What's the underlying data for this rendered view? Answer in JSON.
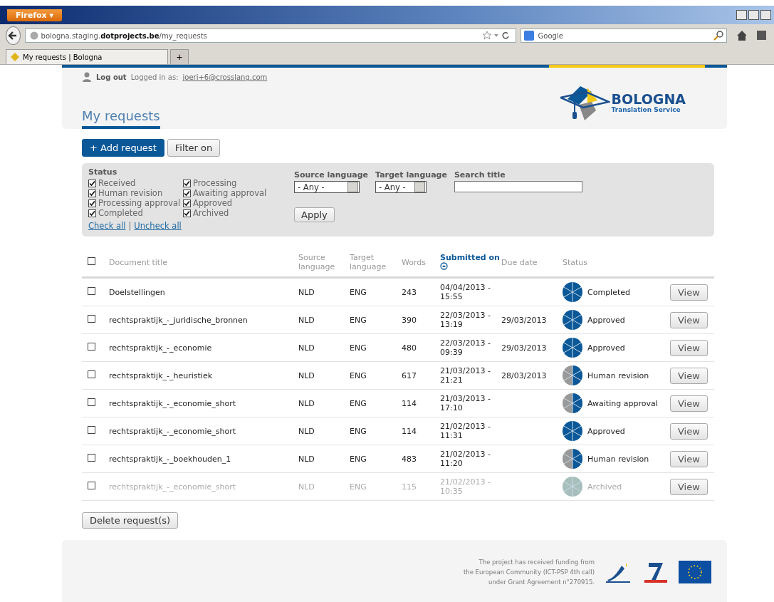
{
  "browser": {
    "menu_button": "Firefox",
    "menu_caret": "▾",
    "url": "bologna.staging.**dotprojects.be**/my_requests",
    "search_placeholder": "Google",
    "tab_title": "My requests | Bologna",
    "new_tab": "+"
  },
  "header": {
    "logout": "Log out",
    "logged_in_label": "Logged in as:",
    "user_email": "joeri+6@crosslang.com",
    "title": "My requests",
    "logo_name": "BOLOGNA",
    "logo_subtitle": "Translation Service"
  },
  "actions": {
    "add": "+ Add request",
    "filter": "Filter on"
  },
  "filter": {
    "status_label": "Status",
    "statuses": [
      {
        "label": "Received",
        "checked": true
      },
      {
        "label": "Human revision",
        "checked": true
      },
      {
        "label": "Processing approval",
        "checked": true
      },
      {
        "label": "Completed",
        "checked": true
      },
      {
        "label": "Processing",
        "checked": true
      },
      {
        "label": "Awaiting approval",
        "checked": true
      },
      {
        "label": "Approved",
        "checked": true
      },
      {
        "label": "Archived",
        "checked": true
      }
    ],
    "check_all": "Check all",
    "uncheck_all": "Uncheck all",
    "separator": "|",
    "source_label": "Source language",
    "source_value": "- Any -",
    "target_label": "Target language",
    "target_value": "- Any -",
    "search_label": "Search title",
    "apply": "Apply"
  },
  "table": {
    "select_all_checked": false,
    "columns": [
      "Document title",
      "Source language",
      "Target language",
      "Words",
      "Submitted on",
      "Due date",
      "Status"
    ],
    "rows": [
      {
        "checked": false,
        "title": "Doelstellingen",
        "source": "NLD",
        "target": "ENG",
        "words": "243",
        "submitted": "04/04/2013 - 15:55",
        "due": "",
        "status": "Completed",
        "kind": "done",
        "action": "View"
      },
      {
        "checked": false,
        "title": "rechtspraktijk_-_juridische_bronnen",
        "source": "NLD",
        "target": "ENG",
        "words": "390",
        "submitted": "22/03/2013 - 13:19",
        "due": "29/03/2013",
        "status": "Approved",
        "kind": "done",
        "action": "View"
      },
      {
        "checked": false,
        "title": "rechtspraktijk_-_economie",
        "source": "NLD",
        "target": "ENG",
        "words": "480",
        "submitted": "22/03/2013 - 09:39",
        "due": "29/03/2013",
        "status": "Approved",
        "kind": "done",
        "action": "View"
      },
      {
        "checked": false,
        "title": "rechtspraktijk_-_heuristiek",
        "source": "NLD",
        "target": "ENG",
        "words": "617",
        "submitted": "21/03/2013 - 21:21",
        "due": "28/03/2013",
        "status": "Human revision",
        "kind": "partial",
        "action": "View"
      },
      {
        "checked": false,
        "title": "rechtspraktijk_-_economie_short",
        "source": "NLD",
        "target": "ENG",
        "words": "114",
        "submitted": "21/03/2013 - 17:10",
        "due": "",
        "status": "Awaiting approval",
        "kind": "partial",
        "action": "View"
      },
      {
        "checked": false,
        "title": "rechtspraktijk_-_economie_short",
        "source": "NLD",
        "target": "ENG",
        "words": "114",
        "submitted": "21/02/2013 - 11:31",
        "due": "",
        "status": "Approved",
        "kind": "done",
        "action": "View"
      },
      {
        "checked": false,
        "title": "rechtspraktijk_-_boekhouden_1",
        "source": "NLD",
        "target": "ENG",
        "words": "483",
        "submitted": "21/02/2013 - 11:20",
        "due": "",
        "status": "Human revision",
        "kind": "partial",
        "action": "View"
      },
      {
        "checked": false,
        "title": "rechtspraktijk_-_economie_short",
        "source": "NLD",
        "target": "ENG",
        "words": "115",
        "submitted": "21/02/2013 - 10:35",
        "due": "",
        "status": "Archived",
        "kind": "archived",
        "action": "View"
      }
    ]
  },
  "delete_button": "Delete request(s)",
  "footer": {
    "funding_lines": [
      "The project has received funding from",
      "the European Community (ICT-PSP 4th call)",
      "under Grant Agreement n°270915."
    ]
  }
}
